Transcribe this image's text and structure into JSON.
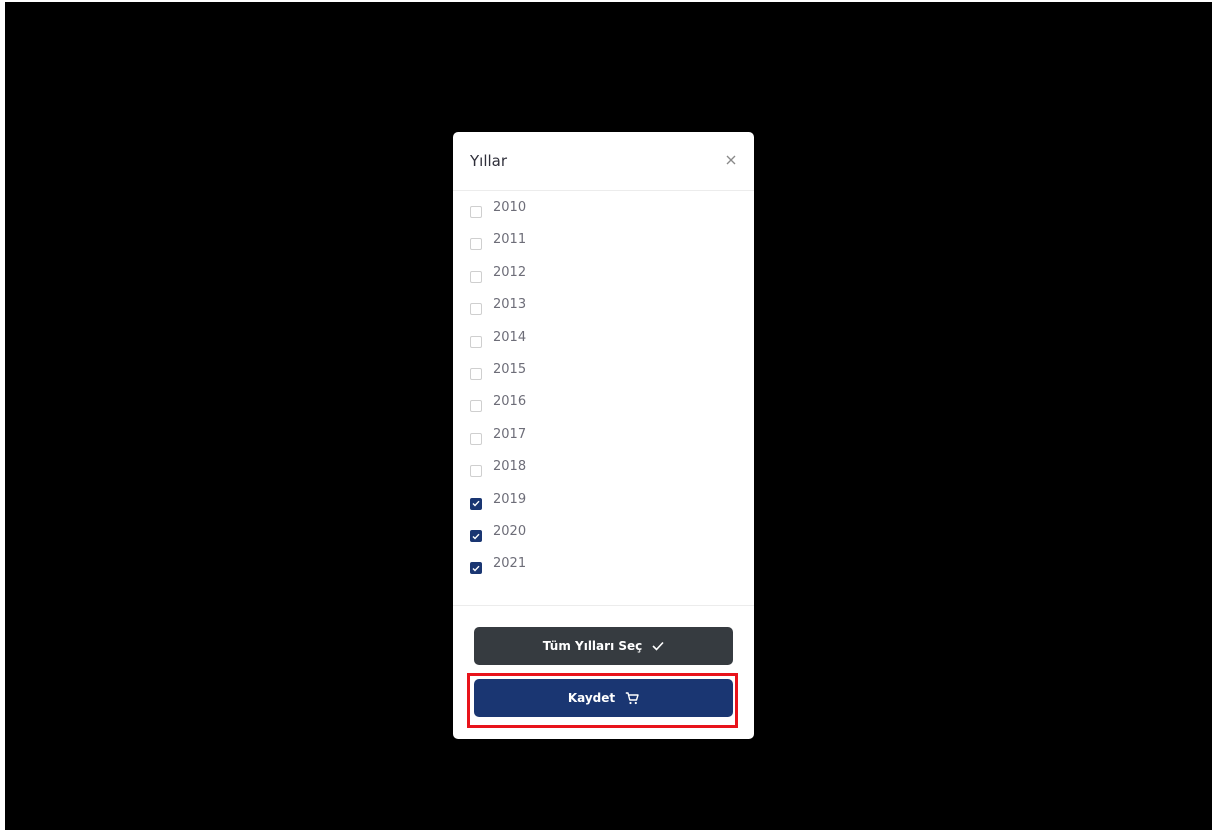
{
  "modal": {
    "title": "Yıllar",
    "close_icon": "close-icon"
  },
  "years": [
    {
      "label": "2010",
      "checked": false
    },
    {
      "label": "2011",
      "checked": false
    },
    {
      "label": "2012",
      "checked": false
    },
    {
      "label": "2013",
      "checked": false
    },
    {
      "label": "2014",
      "checked": false
    },
    {
      "label": "2015",
      "checked": false
    },
    {
      "label": "2016",
      "checked": false
    },
    {
      "label": "2017",
      "checked": false
    },
    {
      "label": "2018",
      "checked": false
    },
    {
      "label": "2019",
      "checked": true
    },
    {
      "label": "2020",
      "checked": true
    },
    {
      "label": "2021",
      "checked": true
    }
  ],
  "footer": {
    "select_all_label": "Tüm Yılları Seç",
    "select_all_icon": "check-icon",
    "save_label": "Kaydet",
    "save_icon": "cart-icon"
  },
  "colors": {
    "backdrop": "#000000",
    "accent": "#1a3672",
    "secondary_button": "#363b40",
    "highlight": "#e8131b"
  }
}
